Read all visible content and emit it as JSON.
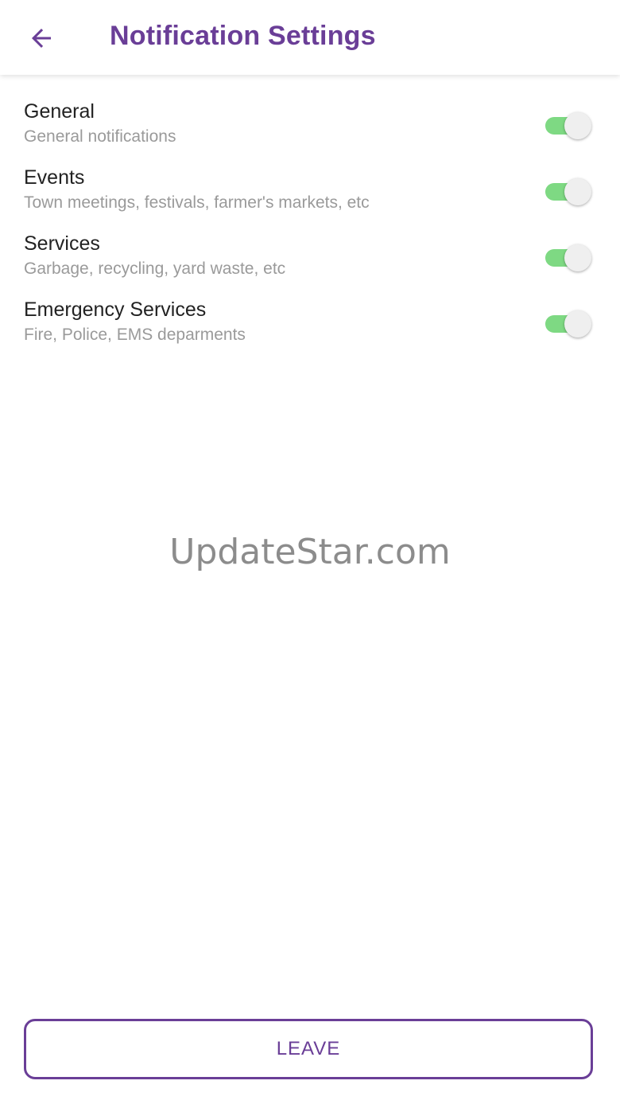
{
  "appbar": {
    "title": "Notification Settings",
    "back_icon": "arrow-left-icon",
    "accent_color": "#6A3E97"
  },
  "settings": [
    {
      "title": "General",
      "description": "General notifications",
      "enabled": true
    },
    {
      "title": "Events",
      "description": "Town meetings, festivals, farmer's markets, etc",
      "enabled": true
    },
    {
      "title": "Services",
      "description": "Garbage, recycling, yard waste, etc",
      "enabled": true
    },
    {
      "title": "Emergency Services",
      "description": "Fire, Police, EMS deparments",
      "enabled": true
    }
  ],
  "toggle_colors": {
    "track_on": "#7ED983",
    "thumb": "#efefef"
  },
  "watermark": "UpdateStar.com",
  "footer": {
    "leave_label": "LEAVE"
  }
}
